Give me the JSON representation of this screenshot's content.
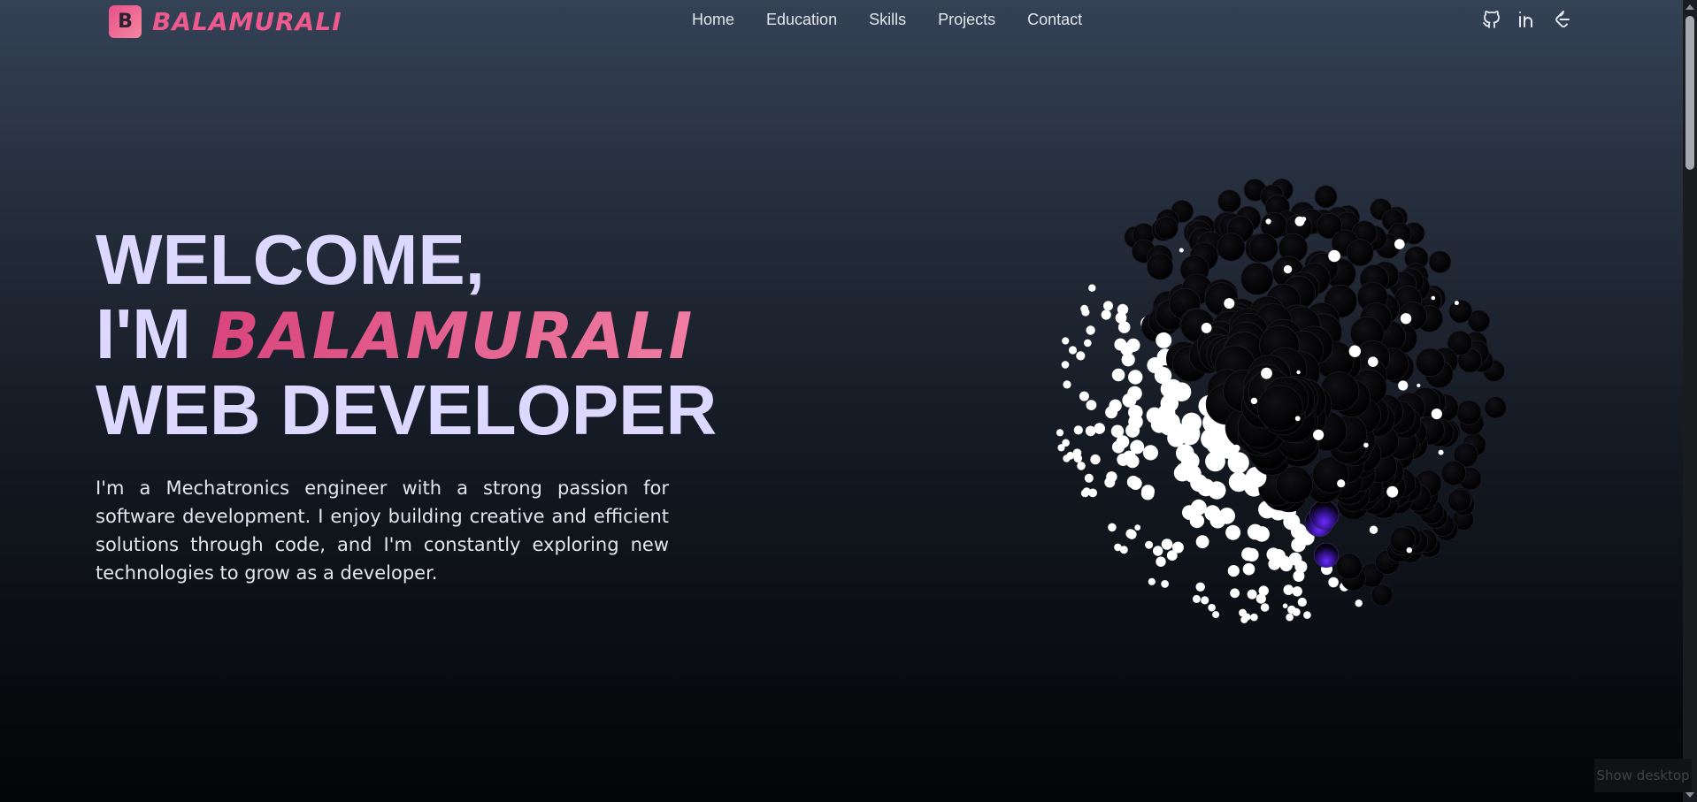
{
  "nav": {
    "logo_letter": "B",
    "brand": "BALAMURALI",
    "links": [
      "Home",
      "Education",
      "Skills",
      "Projects",
      "Contact"
    ],
    "icons": [
      "github-icon",
      "linkedin-icon",
      "leetcode-icon"
    ]
  },
  "hero": {
    "line1": "WELCOME,",
    "line2_prefix": "I'M ",
    "name": "BALAMURALI",
    "line3": "WEB DEVELOPER",
    "description": "I'm a Mechatronics engineer with a strong passion for software development. I enjoy building creative and efficient solutions through code, and I'm constantly exploring new technologies to grow as a developer."
  },
  "taskbar": {
    "show_desktop": "Show desktop"
  },
  "colors": {
    "accent_pink": "#ec5a8e",
    "heading": "#ddd8ff",
    "sphere_glow": "#5a1cff"
  }
}
